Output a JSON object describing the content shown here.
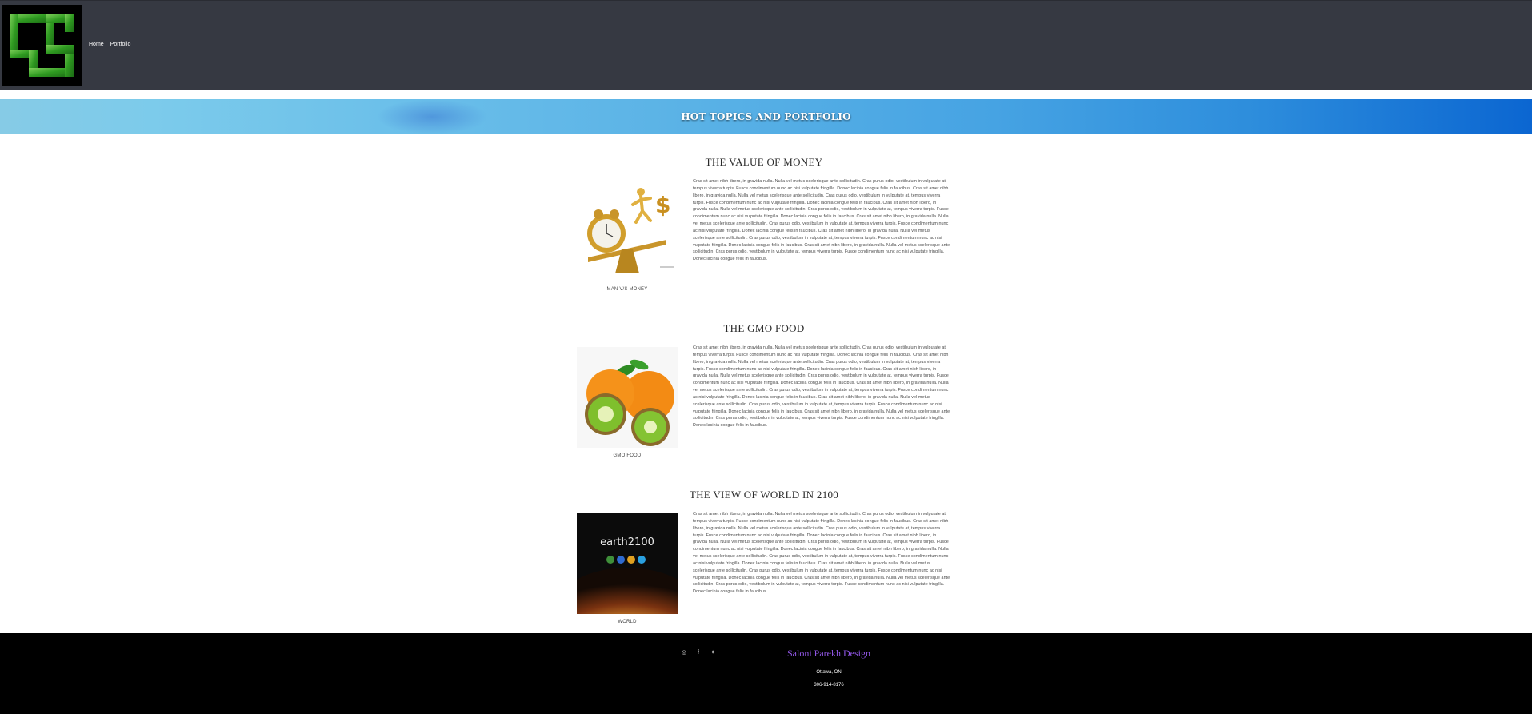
{
  "header": {
    "nav": [
      {
        "label": "Home"
      },
      {
        "label": "Portfolio"
      }
    ]
  },
  "banner": {
    "title": "HOT TOPICS AND PORTFOLIO"
  },
  "sections": [
    {
      "title": "THE VALUE OF MONEY",
      "caption": "MAN V/S MONEY",
      "image": "clock-vs-money-image",
      "body": "Cras sit amet nibh libero, in gravida nulla. Nulla vel metus scelerisque ante sollicitudin. Cras purus odio, vestibulum in vulputate at, tempus viverra turpis. Fusce condimentum nunc ac nisi vulputate fringilla. Donec lacinia congue felis in faucibus. Cras sit amet nibh libero, in gravida nulla. Nulla vel metus scelerisque ante sollicitudin. Cras purus odio, vestibulum in vulputate at, tempus viverra turpis. Fusce condimentum nunc ac nisi vulputate fringilla. Donec lacinia congue felis in faucibus. Cras sit amet nibh libero, in gravida nulla. Nulla vel metus scelerisque ante sollicitudin. Cras purus odio, vestibulum in vulputate at, tempus viverra turpis. Fusce condimentum nunc ac nisi vulputate fringilla. Donec lacinia congue felis in faucibus. Cras sit amet nibh libero, in gravida nulla. Nulla vel metus scelerisque ante sollicitudin. Cras purus odio, vestibulum in vulputate at, tempus viverra turpis. Fusce condimentum nunc ac nisi vulputate fringilla. Donec lacinia congue felis in faucibus. Cras sit amet nibh libero, in gravida nulla. Nulla vel metus scelerisque ante sollicitudin. Cras purus odio, vestibulum in vulputate at, tempus viverra turpis. Fusce condimentum nunc ac nisi vulputate fringilla. Donec lacinia congue felis in faucibus. Cras sit amet nibh libero, in gravida nulla. Nulla vel metus scelerisque ante sollicitudin. Cras purus odio, vestibulum in vulputate at, tempus viverra turpis. Fusce condimentum nunc ac nisi vulputate fringilla. Donec lacinia congue felis in faucibus."
    },
    {
      "title": "THE GMO FOOD",
      "caption": "GMO FOOD",
      "image": "orange-kiwi-image",
      "body": "Cras sit amet nibh libero, in gravida nulla. Nulla vel metus scelerisque ante sollicitudin. Cras purus odio, vestibulum in vulputate at, tempus viverra turpis. Fusce condimentum nunc ac nisi vulputate fringilla. Donec lacinia congue felis in faucibus. Cras sit amet nibh libero, in gravida nulla. Nulla vel metus scelerisque ante sollicitudin. Cras purus odio, vestibulum in vulputate at, tempus viverra turpis. Fusce condimentum nunc ac nisi vulputate fringilla. Donec lacinia congue felis in faucibus. Cras sit amet nibh libero, in gravida nulla. Nulla vel metus scelerisque ante sollicitudin. Cras purus odio, vestibulum in vulputate at, tempus viverra turpis. Fusce condimentum nunc ac nisi vulputate fringilla. Donec lacinia congue felis in faucibus. Cras sit amet nibh libero, in gravida nulla. Nulla vel metus scelerisque ante sollicitudin. Cras purus odio, vestibulum in vulputate at, tempus viverra turpis. Fusce condimentum nunc ac nisi vulputate fringilla. Donec lacinia congue felis in faucibus. Cras sit amet nibh libero, in gravida nulla. Nulla vel metus scelerisque ante sollicitudin. Cras purus odio, vestibulum in vulputate at, tempus viverra turpis. Fusce condimentum nunc ac nisi vulputate fringilla. Donec lacinia congue felis in faucibus. Cras sit amet nibh libero, in gravida nulla. Nulla vel metus scelerisque ante sollicitudin. Cras purus odio, vestibulum in vulputate at, tempus viverra turpis. Fusce condimentum nunc ac nisi vulputate fringilla. Donec lacinia congue felis in faucibus."
    },
    {
      "title": "THE VIEW OF WORLD IN 2100",
      "caption": "WORLD",
      "image": "earth2100-image",
      "image_text": "earth2100",
      "body": "Cras sit amet nibh libero, in gravida nulla. Nulla vel metus scelerisque ante sollicitudin. Cras purus odio, vestibulum in vulputate at, tempus viverra turpis. Fusce condimentum nunc ac nisi vulputate fringilla. Donec lacinia congue felis in faucibus. Cras sit amet nibh libero, in gravida nulla. Nulla vel metus scelerisque ante sollicitudin. Cras purus odio, vestibulum in vulputate at, tempus viverra turpis. Fusce condimentum nunc ac nisi vulputate fringilla. Donec lacinia congue felis in faucibus. Cras sit amet nibh libero, in gravida nulla. Nulla vel metus scelerisque ante sollicitudin. Cras purus odio, vestibulum in vulputate at, tempus viverra turpis. Fusce condimentum nunc ac nisi vulputate fringilla. Donec lacinia congue felis in faucibus. Cras sit amet nibh libero, in gravida nulla. Nulla vel metus scelerisque ante sollicitudin. Cras purus odio, vestibulum in vulputate at, tempus viverra turpis. Fusce condimentum nunc ac nisi vulputate fringilla. Donec lacinia congue felis in faucibus. Cras sit amet nibh libero, in gravida nulla. Nulla vel metus scelerisque ante sollicitudin. Cras purus odio, vestibulum in vulputate at, tempus viverra turpis. Fusce condimentum nunc ac nisi vulputate fringilla. Donec lacinia congue felis in faucibus. Cras sit amet nibh libero, in gravida nulla. Nulla vel metus scelerisque ante sollicitudin. Cras purus odio, vestibulum in vulputate at, tempus viverra turpis. Fusce condimentum nunc ac nisi vulputate fringilla. Donec lacinia congue felis in faucibus."
    }
  ],
  "footer": {
    "social": [
      {
        "icon": "instagram-icon",
        "glyph": "◎"
      },
      {
        "icon": "facebook-icon",
        "glyph": "f"
      },
      {
        "icon": "twitter-icon",
        "glyph": "✦"
      }
    ],
    "brand": "Saloni Parekh Design",
    "city": "Ottawa, ON",
    "phone": "306-914-8176"
  },
  "colors": {
    "header_bg": "#363942",
    "footer_bg": "#000000",
    "brand": "#9156e6",
    "logo_green": "#3fae2a"
  }
}
